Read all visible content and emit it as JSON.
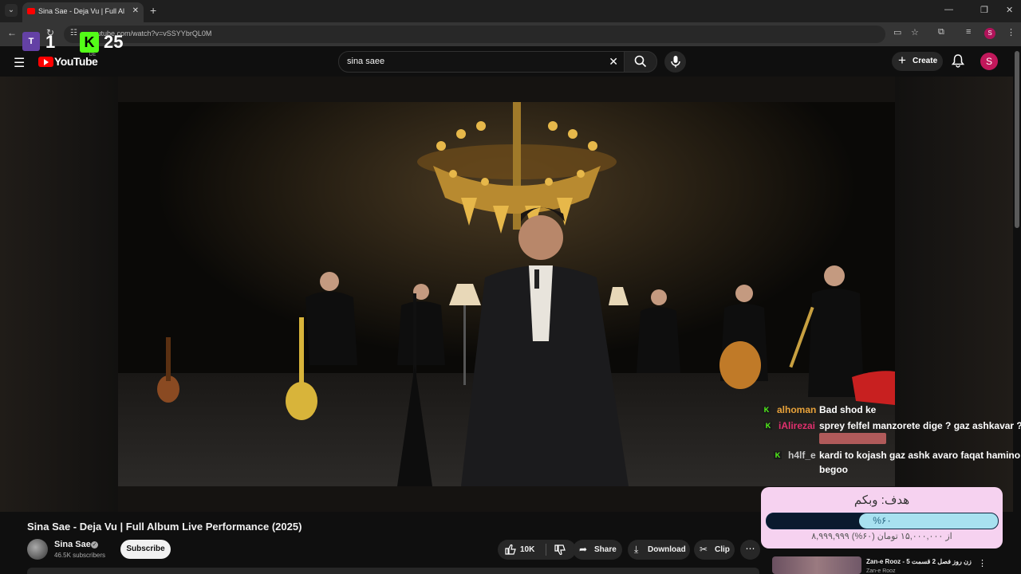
{
  "browser": {
    "tab_title": "Sina Sae - Deja Vu | Full Album",
    "url": "youtube.com/watch?v=vSSYYbrQL0M",
    "new_tab": "+",
    "close": "✕",
    "profile_initial": "S"
  },
  "overlay": {
    "twitch_count": "1",
    "kick_count": "25",
    "kick_letter": "K"
  },
  "youtube": {
    "logo_text": "YouTube",
    "country_code": "DE",
    "search_query": "sina saee",
    "create_label": "Create",
    "avatar_initial": "S"
  },
  "video": {
    "title": "Sina Sae - Deja Vu | Full Album Live Performance (2025)",
    "channel_name": "Sina Sae",
    "subscribers": "46.5K subscribers",
    "subscribe_label": "Subscribe",
    "likes": "10K",
    "share_label": "Share",
    "download_label": "Download",
    "clip_label": "Clip"
  },
  "chat": [
    {
      "user": "alhoman",
      "message": "Bad shod ke",
      "user_color": "#e8a23a"
    },
    {
      "user": "iAlirezai",
      "message": "sprey felfel manzorete dige ? gaz ashkavar ?",
      "user_color": "#e0306e"
    },
    {
      "user": "h4lf_e",
      "message": "kardi to kojash gaz ashk avaro faqat hamino",
      "message2": "begoo",
      "user_color": "#c8c8c8"
    }
  ],
  "goal": {
    "title": "هدف: وبکم",
    "percent_label": "%۶۰",
    "progress": 0.6,
    "amount": "۸,۹۹۹,۹۹۹ از ۱۵,۰۰۰,۰۰۰ تومان (۶۰%)"
  },
  "recommendation": {
    "title": "Zan-e Rooz - 5 زن روز فصل 2 قسمت",
    "channel": "Zan-e Rooz"
  },
  "colors": {
    "youtube_red": "#ff0000",
    "kick_green": "#53fc18",
    "twitch_purple": "#6441a5",
    "goal_bg": "#f6d2f0",
    "goal_fill": "#a8e1f0"
  }
}
